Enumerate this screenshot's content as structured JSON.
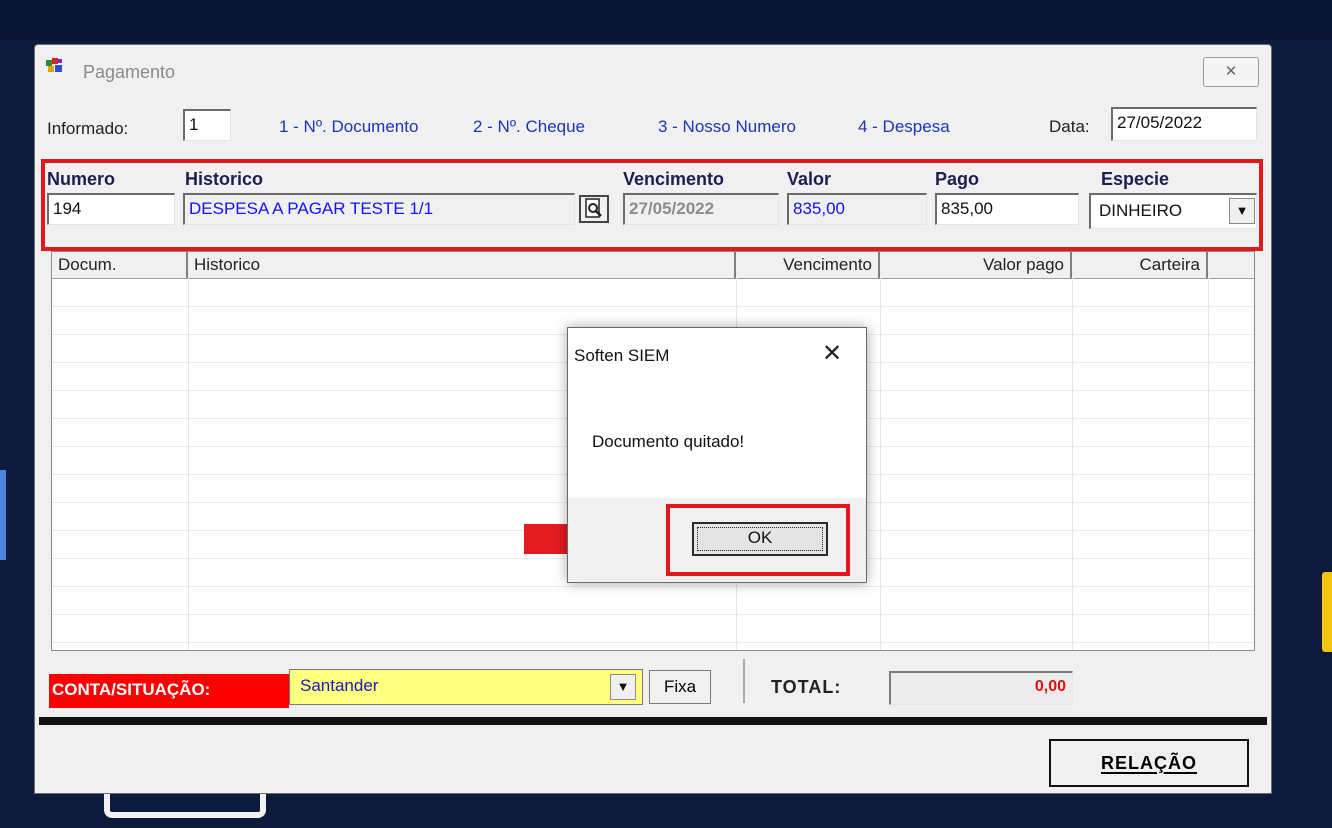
{
  "window": {
    "title": "Pagamento"
  },
  "header": {
    "informado_label": "Informado:",
    "informado_value": "1",
    "options": [
      "1 - Nº. Documento",
      "2 - Nº. Cheque",
      "3 - Nosso Numero",
      "4 - Despesa"
    ],
    "data_label": "Data:",
    "data_value": "27/05/2022"
  },
  "entry": {
    "numero_label": "Numero",
    "numero_value": "194",
    "historico_label": "Historico",
    "historico_value": "DESPESA A PAGAR TESTE 1/1",
    "vencimento_label": "Vencimento",
    "vencimento_value": "27/05/2022",
    "valor_label": "Valor",
    "valor_value": "835,00",
    "pago_label": "Pago",
    "pago_value": "835,00",
    "especie_label": "Especie",
    "especie_value": "DINHEIRO"
  },
  "table": {
    "columns": [
      "Docum.",
      "Historico",
      "Vencimento",
      "Valor pago",
      "Carteira"
    ]
  },
  "dialog": {
    "title": "Soften SIEM",
    "message": "Documento quitado!",
    "ok_label": "OK"
  },
  "footer": {
    "conta_label": "CONTA/SITUAÇÃO:",
    "conta_value": "Santander",
    "fixa_label": "Fixa",
    "total_label": "TOTAL:",
    "total_value": "0,00",
    "relacao_label": "RELAÇÃO"
  },
  "colors": {
    "highlight_red": "#e1191f",
    "conta_yellow": "#ffff80",
    "link_blue": "#1a36b8"
  },
  "icons": [
    "app-icon",
    "close-icon",
    "search-document-icon",
    "dropdown-arrow-icon",
    "arrow-right-icon"
  ]
}
